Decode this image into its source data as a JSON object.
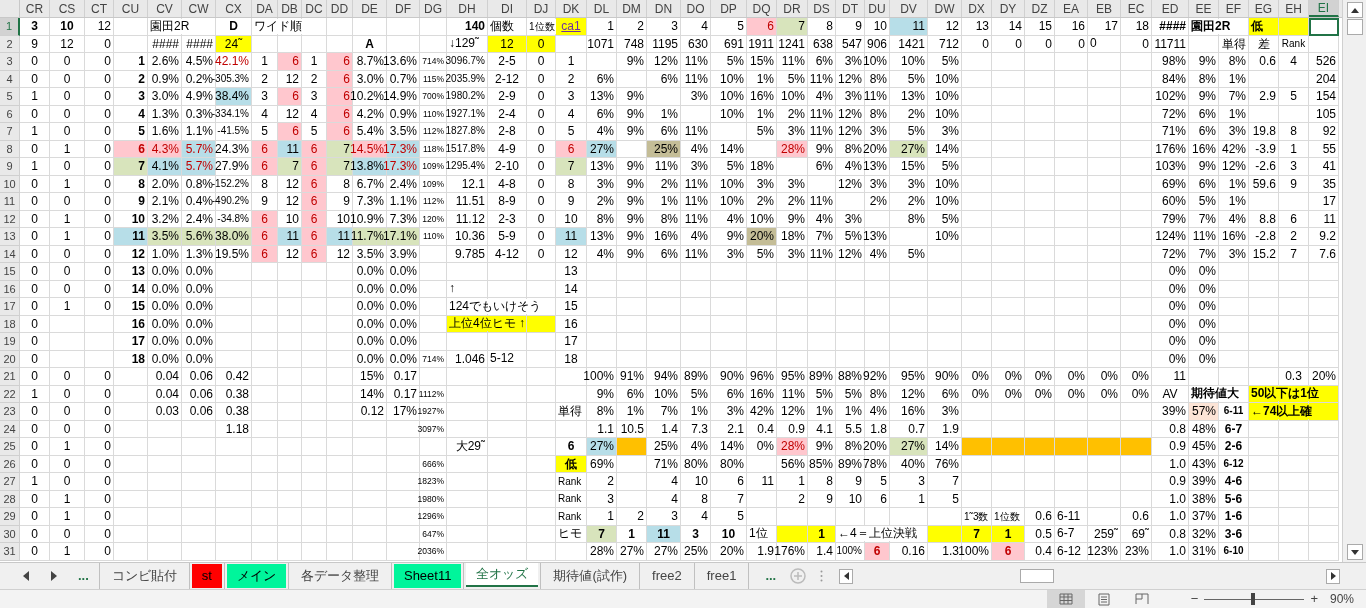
{
  "columns": [
    {
      "label": "CR",
      "selected": false
    },
    {
      "label": "CS",
      "selected": false
    },
    {
      "label": "CT",
      "selected": false
    },
    {
      "label": "CU",
      "selected": false
    },
    {
      "label": "CV",
      "selected": false
    },
    {
      "label": "CW",
      "selected": false
    },
    {
      "label": "CX",
      "selected": false
    },
    {
      "label": "DA",
      "selected": false
    },
    {
      "label": "DB",
      "selected": false
    },
    {
      "label": "DC",
      "selected": false
    },
    {
      "label": "DD",
      "selected": false
    },
    {
      "label": "DE",
      "selected": false
    },
    {
      "label": "DF",
      "selected": false
    },
    {
      "label": "DG",
      "selected": false
    },
    {
      "label": "DH",
      "selected": false
    },
    {
      "label": "DI",
      "selected": false
    },
    {
      "label": "DJ",
      "selected": false
    },
    {
      "label": "DK",
      "selected": false
    },
    {
      "label": "DL",
      "selected": false
    },
    {
      "label": "DM",
      "selected": false
    },
    {
      "label": "DN",
      "selected": false
    },
    {
      "label": "DO",
      "selected": false
    },
    {
      "label": "DP",
      "selected": false
    },
    {
      "label": "DQ",
      "selected": false
    },
    {
      "label": "DR",
      "selected": false
    },
    {
      "label": "DS",
      "selected": false
    },
    {
      "label": "DT",
      "selected": false
    },
    {
      "label": "DU",
      "selected": false
    },
    {
      "label": "DV",
      "selected": false
    },
    {
      "label": "DW",
      "selected": false
    },
    {
      "label": "DX",
      "selected": false
    },
    {
      "label": "DY",
      "selected": false
    },
    {
      "label": "DZ",
      "selected": false
    },
    {
      "label": "EA",
      "selected": false
    },
    {
      "label": "EB",
      "selected": false
    },
    {
      "label": "EC",
      "selected": false
    },
    {
      "label": "ED",
      "selected": false
    },
    {
      "label": "EE",
      "selected": false
    },
    {
      "label": "EF",
      "selected": false
    },
    {
      "label": "EG",
      "selected": false
    },
    {
      "label": "EH",
      "selected": false
    },
    {
      "label": "EI",
      "selected": true
    }
  ],
  "rows": [
    {
      "label": "1",
      "selected": true,
      "cells": [
        {
          "text": "3",
          "bold": true
        },
        {
          "text": "10",
          "bold": true
        },
        "12",
        null,
        {
          "text": "園田2R",
          "kind": "label"
        },
        null,
        {
          "text": "D",
          "bold": true,
          "kind": "center"
        },
        {
          "text": "ワイド順",
          "kind": "label"
        },
        null,
        null,
        null,
        null,
        null,
        null,
        {
          "text": "140",
          "bold": true
        },
        {
          "text": "個数",
          "kind": "label"
        },
        {
          "text": "1位数",
          "kind": "label",
          "small": true
        },
        {
          "text": "ca1",
          "kind": "link",
          "color": "#ffff00"
        },
        "1",
        "2",
        "3",
        "4",
        "5",
        {
          "text": "6",
          "color": "#ffc7ce",
          "alert": true
        },
        {
          "text": "7",
          "color": "#d8e4bc"
        },
        "8",
        "9",
        "10",
        {
          "text": "11",
          "color": "#b7dee8"
        },
        "12",
        "13",
        "14",
        "15",
        "16",
        "17",
        "18",
        {
          "text": "####",
          "bold": true
        },
        {
          "text": "園田2R",
          "kind": "label",
          "bold": true
        },
        null,
        {
          "text": "低",
          "kind": "label",
          "bold": true,
          "color": "#ffff00"
        },
        {
          "color": "#ffff00"
        },
        null
      ]
    },
    {
      "label": "2",
      "selected": false,
      "cells": [
        "9",
        "12",
        "0",
        null,
        "####",
        "####",
        {
          "text": "24˜",
          "kind": "center",
          "color": "#ffff00"
        },
        null,
        null,
        null,
        null,
        {
          "text": "A",
          "bold": true,
          "kind": "center"
        },
        null,
        null,
        {
          "text": "↓129˜",
          "kind": "label"
        },
        {
          "text": "12",
          "color": "#ffff00"
        },
        {
          "text": "0",
          "color": "#ffff00"
        },
        null,
        "1071",
        "748",
        "1195",
        "630",
        "691",
        "1911",
        "1241",
        "638",
        "547",
        "906",
        "1421",
        "712",
        "0",
        "0",
        "0",
        "0",
        {
          "text": "0",
          "kind": "label"
        },
        "0",
        "11711",
        null,
        {
          "text": "単得",
          "kind": "center"
        },
        {
          "text": "差",
          "kind": "center"
        },
        {
          "text": "Rank",
          "kind": "center",
          "small": true
        },
        null
      ]
    },
    {
      "label": "3",
      "selected": false,
      "cells": [
        "0",
        "0",
        "0",
        "1",
        "2.6%",
        "4.5%",
        {
          "text": "42.1%",
          "alert": true
        },
        "1",
        {
          "text": "6",
          "color": "#ffc7ce",
          "alert": true
        },
        "1",
        {
          "text": "6",
          "color": "#ffc7ce",
          "alert": true
        },
        "8.7%",
        "13.6%",
        "714%",
        {
          "text": "3096.7%",
          "small": true
        },
        "2-5",
        "0",
        "1",
        null,
        "9%",
        "12%",
        "11%",
        "5%",
        "15%",
        "11%",
        "6%",
        "3%",
        "10%",
        "10%",
        "5%",
        null,
        null,
        null,
        null,
        null,
        null,
        "98%",
        "9%",
        "8%",
        "0.6",
        "4",
        "526"
      ]
    },
    {
      "label": "4",
      "selected": false,
      "cells": [
        "0",
        "0",
        "0",
        "2",
        "0.9%",
        "0.2%",
        {
          "text": "-305.3%",
          "small": true
        },
        "2",
        "12",
        "2",
        {
          "text": "6",
          "color": "#ffc7ce",
          "alert": true
        },
        "3.0%",
        "0.7%",
        "115%",
        {
          "text": "2035.9%",
          "small": true
        },
        "2-12",
        "0",
        "2",
        "6%",
        null,
        "6%",
        "11%",
        "10%",
        "1%",
        "5%",
        "11%",
        "12%",
        "8%",
        "5%",
        "10%",
        null,
        null,
        null,
        null,
        null,
        null,
        "84%",
        "8%",
        "1%",
        null,
        null,
        "204"
      ]
    },
    {
      "label": "5",
      "selected": false,
      "cells": [
        "1",
        "0",
        "0",
        "3",
        "3.0%",
        "4.9%",
        {
          "text": "38.4%",
          "color": "#b7dee8"
        },
        "3",
        {
          "text": "6",
          "color": "#ffc7ce",
          "alert": true
        },
        "3",
        {
          "text": "6",
          "color": "#ffc7ce",
          "alert": true
        },
        "10.2%",
        "14.9%",
        "700%",
        {
          "text": "1980.2%",
          "small": true
        },
        "2-9",
        "0",
        "3",
        "13%",
        "9%",
        null,
        "3%",
        "10%",
        "16%",
        "10%",
        "4%",
        "3%",
        "11%",
        "13%",
        "10%",
        null,
        null,
        null,
        null,
        null,
        null,
        "102%",
        "9%",
        "7%",
        "2.9",
        "5",
        "154"
      ]
    },
    {
      "label": "6",
      "selected": false,
      "cells": [
        "0",
        "0",
        "0",
        "4",
        "1.3%",
        "0.3%",
        {
          "text": "-334.1%",
          "small": true
        },
        "4",
        "12",
        "4",
        {
          "text": "6",
          "color": "#ffc7ce",
          "alert": true
        },
        "4.2%",
        "0.9%",
        "110%",
        {
          "text": "1927.1%",
          "small": true
        },
        "2-4",
        "0",
        "4",
        "6%",
        "9%",
        "1%",
        null,
        "10%",
        "1%",
        "2%",
        "11%",
        "12%",
        "8%",
        "2%",
        "10%",
        null,
        null,
        null,
        null,
        null,
        null,
        "72%",
        "6%",
        "1%",
        null,
        null,
        "105"
      ]
    },
    {
      "label": "7",
      "selected": false,
      "cells": [
        "1",
        "0",
        "0",
        "5",
        "1.6%",
        "1.1%",
        {
          "text": "-41.5%",
          "small": true
        },
        "5",
        {
          "text": "6",
          "color": "#ffc7ce",
          "alert": true
        },
        "5",
        {
          "text": "6",
          "color": "#ffc7ce",
          "alert": true
        },
        "5.4%",
        "3.5%",
        "112%",
        {
          "text": "1827.8%",
          "small": true
        },
        "2-8",
        "0",
        "5",
        "4%",
        "9%",
        "6%",
        "11%",
        null,
        "5%",
        "3%",
        "11%",
        "12%",
        "3%",
        "5%",
        "3%",
        null,
        null,
        null,
        null,
        null,
        null,
        "71%",
        "6%",
        "3%",
        "19.8",
        "8",
        "92"
      ]
    },
    {
      "label": "8",
      "selected": false,
      "cells": [
        "0",
        "1",
        "0",
        {
          "text": "6",
          "color": "#ffc7ce",
          "alert": true
        },
        {
          "text": "4.3%",
          "color": "#ffc7ce",
          "alert": true
        },
        {
          "text": "5.7%",
          "color": "#b7dee8",
          "alert": true
        },
        "24.3%",
        {
          "text": "6",
          "color": "#ffc7ce",
          "alert": true
        },
        {
          "text": "11",
          "color": "#b7dee8"
        },
        {
          "text": "6",
          "color": "#ffc7ce",
          "alert": true
        },
        {
          "text": "7",
          "color": "#d8e4bc"
        },
        {
          "text": "14.5%",
          "color": "#ffc7ce",
          "alert": true
        },
        {
          "text": "17.3%",
          "color": "#b7dee8",
          "alert": true
        },
        "118%",
        {
          "text": "1517.8%",
          "small": true
        },
        "4-9",
        "0",
        {
          "text": "6",
          "color": "#ffc7ce",
          "alert": true
        },
        {
          "text": "27%",
          "color": "#b7dee8"
        },
        null,
        {
          "text": "25%",
          "color": "#c4bd97"
        },
        "4%",
        "14%",
        null,
        {
          "text": "28%",
          "color": "#ffc7ce",
          "alert": true
        },
        "9%",
        "8%",
        "20%",
        {
          "text": "27%",
          "color": "#d8e4bc"
        },
        "14%",
        null,
        null,
        null,
        null,
        null,
        null,
        "176%",
        "16%",
        "42%",
        "-3.9",
        "1",
        "55"
      ]
    },
    {
      "label": "9",
      "selected": false,
      "cells": [
        "1",
        "0",
        "0",
        {
          "text": "7",
          "color": "#d8e4bc"
        },
        {
          "text": "4.1%",
          "color": "#b7dee8"
        },
        {
          "text": "5.7%",
          "color": "#b7dee8",
          "alert": true
        },
        "27.9%",
        {
          "text": "6",
          "color": "#ffc7ce",
          "alert": true
        },
        {
          "text": "7",
          "color": "#d8e4bc"
        },
        {
          "text": "6",
          "color": "#ffc7ce",
          "alert": true
        },
        {
          "text": "7",
          "color": "#d8e4bc"
        },
        {
          "text": "13.8%",
          "color": "#b7dee8"
        },
        {
          "text": "17.3%",
          "color": "#b7dee8",
          "alert": true
        },
        "109%",
        {
          "text": "1295.4%",
          "small": true
        },
        "2-10",
        "0",
        {
          "text": "7",
          "color": "#d8e4bc"
        },
        "13%",
        "9%",
        "11%",
        "3%",
        "5%",
        "18%",
        null,
        "6%",
        "4%",
        "13%",
        "15%",
        "5%",
        null,
        null,
        null,
        null,
        null,
        null,
        "103%",
        "9%",
        "12%",
        "-2.6",
        "3",
        "41"
      ]
    },
    {
      "label": "10",
      "selected": false,
      "cells": [
        "0",
        "1",
        "0",
        "8",
        "2.0%",
        "0.8%",
        {
          "text": "-152.2%",
          "small": true
        },
        "8",
        "12",
        {
          "text": "6",
          "color": "#ffc7ce",
          "alert": true
        },
        "8",
        "6.7%",
        "2.4%",
        "109%",
        "12.1",
        "4-8",
        "0",
        "8",
        "3%",
        "9%",
        "2%",
        "11%",
        "10%",
        "3%",
        "3%",
        null,
        "12%",
        "3%",
        "3%",
        "10%",
        null,
        null,
        null,
        null,
        null,
        null,
        "69%",
        "6%",
        "1%",
        "59.6",
        "9",
        "35"
      ]
    },
    {
      "label": "11",
      "selected": false,
      "cells": [
        "0",
        "0",
        "0",
        "9",
        "2.1%",
        "0.4%",
        {
          "text": "-490.2%",
          "small": true
        },
        "9",
        "12",
        {
          "text": "6",
          "color": "#ffc7ce",
          "alert": true
        },
        "9",
        "7.3%",
        "1.1%",
        "112%",
        "11.51",
        "8-9",
        "0",
        "9",
        "2%",
        "9%",
        "1%",
        "11%",
        "10%",
        "2%",
        "2%",
        "11%",
        null,
        "2%",
        "2%",
        "10%",
        null,
        null,
        null,
        null,
        null,
        null,
        "60%",
        "5%",
        "1%",
        null,
        null,
        "17"
      ]
    },
    {
      "label": "12",
      "selected": false,
      "cells": [
        "0",
        "1",
        "0",
        "10",
        "3.2%",
        "2.4%",
        {
          "text": "-34.8%",
          "small": true
        },
        {
          "text": "6",
          "color": "#ffc7ce",
          "alert": true
        },
        "10",
        {
          "text": "6",
          "color": "#ffc7ce",
          "alert": true
        },
        "10",
        "10.9%",
        "7.3%",
        "120%",
        "11.12",
        "2-3",
        "0",
        "10",
        "8%",
        "9%",
        "8%",
        "11%",
        "4%",
        "10%",
        "9%",
        "4%",
        "3%",
        null,
        "8%",
        "5%",
        null,
        null,
        null,
        null,
        null,
        null,
        "79%",
        "7%",
        "4%",
        "8.8",
        "6",
        "11"
      ]
    },
    {
      "label": "13",
      "selected": false,
      "cells": [
        "0",
        "1",
        "0",
        {
          "text": "11",
          "color": "#b7dee8"
        },
        {
          "text": "3.5%",
          "color": "#d8e4bc"
        },
        {
          "text": "5.6%",
          "color": "#d8e4bc"
        },
        {
          "text": "38.0%",
          "color": "#d8e4bc"
        },
        {
          "text": "6",
          "color": "#ffc7ce",
          "alert": true
        },
        {
          "text": "11",
          "color": "#b7dee8"
        },
        {
          "text": "6",
          "color": "#ffc7ce",
          "alert": true
        },
        {
          "text": "11",
          "color": "#b7dee8"
        },
        {
          "text": "11.7%",
          "color": "#d8e4bc"
        },
        {
          "text": "17.1%",
          "color": "#d8e4bc"
        },
        "110%",
        "10.36",
        "5-9",
        "0",
        {
          "text": "11",
          "color": "#b7dee8"
        },
        "13%",
        "9%",
        "16%",
        "4%",
        "9%",
        {
          "text": "20%",
          "color": "#c4bd97"
        },
        "18%",
        "7%",
        "5%",
        "13%",
        null,
        "10%",
        null,
        null,
        null,
        null,
        null,
        null,
        "124%",
        "11%",
        "16%",
        "-2.8",
        "2",
        "9.2"
      ]
    },
    {
      "label": "14",
      "selected": false,
      "cells": [
        "0",
        "0",
        "0",
        "12",
        "1.0%",
        "1.3%",
        "19.5%",
        {
          "text": "6",
          "color": "#ffc7ce",
          "alert": true
        },
        "12",
        {
          "text": "6",
          "color": "#ffc7ce",
          "alert": true
        },
        "12",
        "3.5%",
        "3.9%",
        null,
        "9.785",
        "4-12",
        "0",
        "12",
        "4%",
        "9%",
        "6%",
        "11%",
        "3%",
        "5%",
        "3%",
        "11%",
        "12%",
        "4%",
        "5%",
        null,
        null,
        null,
        null,
        null,
        null,
        null,
        "72%",
        "7%",
        "3%",
        "15.2",
        "7",
        "7.6"
      ]
    },
    {
      "label": "15",
      "selected": false,
      "cells": [
        "0",
        "0",
        "0",
        "13",
        "0.0%",
        "0.0%",
        null,
        null,
        null,
        null,
        null,
        "0.0%",
        "0.0%",
        null,
        null,
        null,
        null,
        "13",
        null,
        null,
        null,
        null,
        null,
        null,
        null,
        null,
        null,
        null,
        null,
        null,
        null,
        null,
        null,
        null,
        null,
        null,
        "0%",
        "0%",
        null,
        null,
        null,
        null
      ]
    },
    {
      "label": "16",
      "selected": false,
      "cells": [
        "0",
        "0",
        "0",
        "14",
        "0.0%",
        "0.0%",
        null,
        null,
        null,
        null,
        null,
        "0.0%",
        "0.0%",
        null,
        {
          "text": "↑",
          "kind": "label"
        },
        null,
        null,
        "14",
        null,
        null,
        null,
        null,
        null,
        null,
        null,
        null,
        null,
        null,
        null,
        null,
        null,
        null,
        null,
        null,
        null,
        null,
        "0%",
        "0%",
        null,
        null,
        null,
        null
      ]
    },
    {
      "label": "17",
      "selected": false,
      "cells": [
        "0",
        "1",
        "0",
        "15",
        "0.0%",
        "0.0%",
        null,
        null,
        null,
        null,
        null,
        "0.0%",
        "0.0%",
        null,
        {
          "text": "124でもいけそう",
          "kind": "label"
        },
        null,
        null,
        "15",
        null,
        null,
        null,
        null,
        null,
        null,
        null,
        null,
        null,
        null,
        null,
        null,
        null,
        null,
        null,
        null,
        null,
        null,
        "0%",
        "0%",
        null,
        null,
        null,
        null
      ]
    },
    {
      "label": "18",
      "selected": false,
      "cells": [
        "0",
        null,
        null,
        "16",
        "0.0%",
        "0.0%",
        null,
        null,
        null,
        null,
        null,
        "0.0%",
        "0.0%",
        null,
        {
          "text": "上位4位ヒモ ↑",
          "kind": "label",
          "color": "#ffff00"
        },
        {
          "color": "#ffff00"
        },
        {
          "color": "#ffff00"
        },
        "16",
        null,
        null,
        null,
        null,
        null,
        null,
        null,
        null,
        null,
        null,
        null,
        null,
        null,
        null,
        null,
        null,
        null,
        null,
        "0%",
        "0%",
        null,
        null,
        null,
        null
      ]
    },
    {
      "label": "19",
      "selected": false,
      "cells": [
        "0",
        null,
        null,
        "17",
        "0.0%",
        "0.0%",
        null,
        null,
        null,
        null,
        null,
        "0.0%",
        "0.0%",
        null,
        null,
        null,
        null,
        "17",
        null,
        null,
        null,
        null,
        null,
        null,
        null,
        null,
        null,
        null,
        null,
        null,
        null,
        null,
        null,
        null,
        null,
        null,
        "0%",
        "0%",
        null,
        null,
        null,
        null
      ]
    },
    {
      "label": "20",
      "selected": false,
      "cells": [
        "0",
        null,
        null,
        "18",
        "0.0%",
        "0.0%",
        null,
        null,
        null,
        null,
        null,
        "0.0%",
        "0.0%",
        "714%",
        "1.046",
        {
          "text": "5-12",
          "kind": "label"
        },
        null,
        "18",
        null,
        null,
        null,
        null,
        null,
        null,
        null,
        null,
        null,
        null,
        null,
        null,
        null,
        null,
        null,
        null,
        null,
        null,
        "0%",
        "0%",
        null,
        null,
        null,
        null
      ]
    },
    {
      "label": "21",
      "selected": false,
      "cells": [
        "0",
        "0",
        "0",
        null,
        "0.04",
        "0.06",
        "0.42",
        null,
        null,
        null,
        null,
        "15%",
        "0.17",
        null,
        null,
        null,
        null,
        null,
        "100%",
        "91%",
        "94%",
        "89%",
        "90%",
        "96%",
        "95%",
        "89%",
        "88%",
        "92%",
        "95%",
        "90%",
        "0%",
        "0%",
        "0%",
        "0%",
        "0%",
        "0%",
        "11",
        null,
        null,
        null,
        "0.3",
        "20%"
      ]
    },
    {
      "label": "22",
      "selected": false,
      "cells": [
        "1",
        "0",
        "0",
        null,
        "0.04",
        "0.06",
        "0.38",
        null,
        null,
        null,
        null,
        "14%",
        "0.17",
        "1112%",
        null,
        null,
        null,
        null,
        "9%",
        "6%",
        "10%",
        "5%",
        "6%",
        "16%",
        "11%",
        "5%",
        "5%",
        "8%",
        "12%",
        "6%",
        "0%",
        "0%",
        "0%",
        "0%",
        "0%",
        "0%",
        {
          "text": "AV",
          "kind": "center"
        },
        {
          "text": "期待値大",
          "kind": "label",
          "bold": true
        },
        null,
        {
          "text": "50以下は1位",
          "kind": "label",
          "bold": true,
          "color": "#ffff00"
        },
        {
          "color": "#ffff00"
        },
        {
          "color": "#ffff00"
        }
      ]
    },
    {
      "label": "23",
      "selected": false,
      "cells": [
        "0",
        "0",
        "0",
        null,
        "0.03",
        "0.06",
        "0.38",
        null,
        null,
        null,
        null,
        "0.12",
        "17%",
        "1927%",
        null,
        null,
        null,
        {
          "text": "単得",
          "kind": "label"
        },
        "8%",
        "1%",
        "7%",
        "1%",
        "3%",
        "42%",
        "12%",
        "1%",
        "1%",
        "4%",
        "16%",
        "3%",
        null,
        null,
        null,
        null,
        null,
        null,
        "39%",
        {
          "text": "57%",
          "color": "#fce4d6"
        },
        {
          "text": "6-11",
          "bold": true,
          "small": true,
          "kind": "center"
        },
        {
          "text": "←74以上確",
          "kind": "label",
          "bold": true,
          "color": "#ffff00"
        },
        {
          "color": "#ffff00"
        },
        {
          "color": "#ffff00"
        }
      ]
    },
    {
      "label": "24",
      "selected": false,
      "cells": [
        "0",
        "0",
        "0",
        null,
        null,
        null,
        "1.18",
        null,
        null,
        null,
        null,
        null,
        null,
        "3097%",
        null,
        null,
        null,
        null,
        "1.1",
        "10.5",
        "1.4",
        "7.3",
        "2.1",
        "0.4",
        "0.9",
        "4.1",
        "5.5",
        "1.8",
        "0.7",
        "1.9",
        null,
        null,
        null,
        null,
        null,
        null,
        "0.8",
        "48%",
        {
          "text": "6-7",
          "bold": true,
          "kind": "center"
        },
        null,
        null,
        null
      ]
    },
    {
      "label": "25",
      "selected": false,
      "cells": [
        "0",
        "1",
        "0",
        null,
        null,
        null,
        null,
        null,
        null,
        null,
        null,
        null,
        null,
        null,
        "大29˜",
        null,
        null,
        {
          "text": "6",
          "bold": true,
          "kind": "center"
        },
        {
          "text": "27%",
          "color": "#b7dee8"
        },
        {
          "color": "#ffc000"
        },
        "25%",
        "4%",
        "14%",
        "0%",
        {
          "text": "28%",
          "color": "#ffc7ce",
          "alert": true
        },
        "9%",
        "8%",
        "20%",
        {
          "text": "27%",
          "color": "#d8e4bc"
        },
        "14%",
        {
          "color": "#ffc000"
        },
        {
          "color": "#ffc000"
        },
        {
          "color": "#ffc000"
        },
        {
          "color": "#ffc000"
        },
        {
          "color": "#ffc000"
        },
        {
          "color": "#ffc000"
        },
        "0.9",
        "45%",
        {
          "text": "2-6",
          "bold": true,
          "kind": "center"
        },
        null,
        null,
        null
      ]
    },
    {
      "label": "26",
      "selected": false,
      "cells": [
        "0",
        "0",
        "0",
        null,
        null,
        null,
        null,
        null,
        null,
        null,
        null,
        null,
        null,
        "666%",
        null,
        null,
        null,
        {
          "text": "低",
          "bold": true,
          "kind": "center",
          "color": "#ffff00"
        },
        "69%",
        null,
        "71%",
        "80%",
        "80%",
        null,
        "56%",
        "85%",
        "89%",
        "78%",
        "40%",
        "76%",
        null,
        null,
        null,
        null,
        null,
        null,
        "1.0",
        "43%",
        {
          "text": "6-12",
          "bold": true,
          "small": true,
          "kind": "center"
        },
        null,
        null,
        null
      ]
    },
    {
      "label": "27",
      "selected": false,
      "cells": [
        "1",
        "0",
        "0",
        null,
        null,
        null,
        null,
        null,
        null,
        null,
        null,
        null,
        null,
        "1823%",
        null,
        null,
        null,
        {
          "text": "Rank",
          "kind": "label",
          "small": true
        },
        "2",
        null,
        "4",
        "10",
        "6",
        "11",
        "1",
        "8",
        "9",
        "5",
        "3",
        "7",
        null,
        null,
        null,
        null,
        null,
        null,
        "0.9",
        "39%",
        {
          "text": "4-6",
          "bold": true,
          "kind": "center"
        },
        null,
        null,
        null
      ]
    },
    {
      "label": "28",
      "selected": false,
      "cells": [
        "0",
        "1",
        "0",
        null,
        null,
        null,
        null,
        null,
        null,
        null,
        null,
        null,
        null,
        "1980%",
        null,
        null,
        null,
        {
          "text": "Rank",
          "kind": "label",
          "small": true
        },
        "3",
        null,
        "4",
        "8",
        "7",
        null,
        "2",
        "9",
        "10",
        "6",
        "1",
        "5",
        null,
        null,
        null,
        null,
        null,
        null,
        "1.0",
        "38%",
        {
          "text": "5-6",
          "bold": true,
          "kind": "center"
        },
        null,
        null,
        null
      ]
    },
    {
      "label": "29",
      "selected": false,
      "cells": [
        "0",
        "1",
        "0",
        null,
        null,
        null,
        null,
        null,
        null,
        null,
        null,
        null,
        null,
        "1296%",
        null,
        null,
        null,
        {
          "text": "Rank",
          "kind": "label",
          "small": true
        },
        "1",
        "2",
        "3",
        "4",
        "5",
        null,
        null,
        null,
        null,
        null,
        null,
        null,
        {
          "text": "1˜3数",
          "kind": "label",
          "small": true
        },
        {
          "text": "1位数",
          "kind": "label",
          "small": true
        },
        "0.6",
        {
          "text": "6-11",
          "kind": "label"
        },
        null,
        "0.6",
        "1.0",
        "37%",
        {
          "text": "1-6",
          "bold": true,
          "kind": "center"
        },
        null,
        null,
        null
      ]
    },
    {
      "label": "30",
      "selected": false,
      "cells": [
        "0",
        "0",
        "0",
        null,
        null,
        null,
        null,
        null,
        null,
        null,
        null,
        null,
        null,
        "647%",
        null,
        null,
        null,
        {
          "text": "ヒモ",
          "kind": "label"
        },
        {
          "text": "7",
          "bold": true,
          "kind": "center",
          "color": "#d8e4bc"
        },
        {
          "text": "1",
          "bold": true,
          "kind": "center"
        },
        {
          "text": "11",
          "bold": true,
          "kind": "center",
          "color": "#b7dee8"
        },
        {
          "text": "3",
          "bold": true,
          "kind": "center"
        },
        {
          "text": "10",
          "bold": true,
          "kind": "center"
        },
        {
          "text": "1位",
          "kind": "label"
        },
        {
          "color": "#ffff00"
        },
        {
          "text": "1",
          "bold": true,
          "kind": "center",
          "color": "#ffff00"
        },
        {
          "text": "←4＝上位決戦",
          "kind": "label"
        },
        null,
        null,
        {
          "color": "#ffff00"
        },
        {
          "text": "7",
          "bold": true,
          "kind": "center",
          "color": "#ffff00"
        },
        {
          "text": "1",
          "bold": true,
          "kind": "center",
          "color": "#ffff00"
        },
        "0.5",
        {
          "text": "6-7",
          "kind": "label"
        },
        "259˜",
        "69˜",
        "0.8",
        "32%",
        {
          "text": "3-6",
          "bold": true,
          "kind": "center"
        },
        null,
        null,
        null
      ]
    },
    {
      "label": "31",
      "selected": false,
      "cells": [
        "0",
        "1",
        "0",
        null,
        null,
        null,
        null,
        null,
        null,
        null,
        null,
        null,
        null,
        "2036%",
        null,
        null,
        null,
        null,
        "28%",
        "27%",
        "27%",
        "25%",
        "20%",
        "1.9",
        "176%",
        "1.4",
        {
          "text": "100%",
          "small": true
        },
        {
          "text": "6",
          "bold": true,
          "kind": "center",
          "color": "#ffc7ce",
          "alert": true
        },
        "0.16",
        "1.3",
        "100%",
        {
          "text": "6",
          "bold": true,
          "kind": "center",
          "color": "#ffc7ce",
          "alert": true
        },
        "0.4",
        {
          "text": "6-12",
          "kind": "label"
        },
        "123%",
        "23%",
        "1.0",
        "31%",
        {
          "text": "6-10",
          "bold": true,
          "small": true,
          "kind": "center"
        },
        null,
        null,
        null
      ]
    }
  ],
  "sheet_nav": {
    "more": "..."
  },
  "sheet_tabs": [
    {
      "label": "コンビ貼付",
      "selected": false
    },
    {
      "label": "st",
      "selected": false,
      "color": "#ff0000"
    },
    {
      "label": "メイン",
      "selected": false,
      "color": "#00f59b"
    },
    {
      "label": "各データ整理",
      "selected": false
    },
    {
      "label": "Sheet11",
      "selected": false,
      "color": "#00f59b"
    },
    {
      "label": "全オッズ",
      "selected": true
    },
    {
      "label": "期待値(試作)",
      "selected": false
    },
    {
      "label": "free2",
      "selected": false
    },
    {
      "label": "free1",
      "selected": false
    }
  ],
  "sheet_more": "...",
  "status_bar": {
    "zoom_out": "−",
    "zoom_in": "+",
    "zoom": {
      "level": 0.47,
      "reading": "90%"
    }
  }
}
